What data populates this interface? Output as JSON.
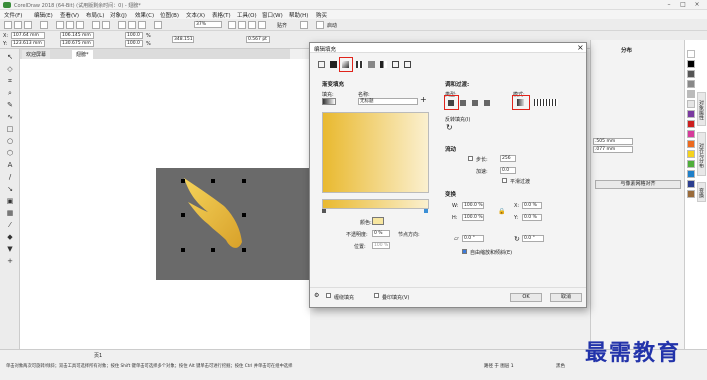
{
  "app": {
    "title": "CorelDraw 2018 (64-Bit) (试用版剩余时间：0) - 翅膀*"
  },
  "menu": [
    "文件(F)",
    "编辑(E)",
    "查看(V)",
    "布局(L)",
    "对象(J)",
    "效果(C)",
    "位图(B)",
    "文本(X)",
    "表格(T)",
    "工具(O)",
    "窗口(W)",
    "帮助(H)",
    "购买"
  ],
  "toolbar": {
    "zoom": "37%",
    "snap_label": "贴齐",
    "launch_label": "启动"
  },
  "propbar": {
    "x": "107.64 mm",
    "y": "123.613 mm",
    "w": "106.145 mm",
    "h": "130.675 mm",
    "sx": "100.0",
    "sy": "100.0",
    "pct": "%",
    "angle": "348.151",
    "outline": "0.567 pt"
  },
  "doc_tabs": {
    "welcome": "欢迎屏幕",
    "doc": "翅膀*"
  },
  "right_panel": {
    "title": "分布",
    "v1": ".505 mm",
    "v2": ".077 mm",
    "align_button": "与像素网格对齐",
    "tabs": [
      "对象属性",
      "对齐与分布",
      "变换"
    ]
  },
  "dialog": {
    "title": "编辑填充",
    "section_gradient": "渐变填充",
    "fill_label": "填充:",
    "name_label": "名称:",
    "name_value": "无标题",
    "color_label": "颜色:",
    "opacity_label": "不透明度:",
    "opacity_value": "0 %",
    "position_label": "位置:",
    "position_value": "100 %",
    "node_dir_label": "节点方向:",
    "section_blend": "调和过渡:",
    "type_label": "类型:",
    "mode_label": "模式:",
    "mirror_label": "反转填充(I)",
    "section_accel": "流动",
    "steps_label": "步长:",
    "steps_value": "256",
    "accel_label": "加速:",
    "accel_value": "0.0",
    "smooth_label": "平滑过渡",
    "section_transform": "变换",
    "w_label": "W:",
    "w_value": "100.0 %",
    "h_label": "H:",
    "h_value": "100.0 %",
    "x_label": "X:",
    "x_value": "0.0 %",
    "y_label": "Y:",
    "y_value": "0.0 %",
    "skew_value": "0.0 °",
    "rotate_value": "0.0 °",
    "free_scale_label": "自由缩放和倾斜(E)",
    "wrap_label": "缠绕填充",
    "overprint_label": "叠印填充(V)",
    "ok": "OK",
    "cancel": "取消",
    "color_swatch": "#f7e6a0",
    "grad_start": "#e9b92f",
    "grad_end": "#fbf0cf"
  },
  "status": {
    "hint": "单击对象两次可旋转/倾斜；双击工具可选择所有对象；按住 Shift 键单击可选择多个对象；按住 Alt 键单击可进行挖掘；按住 Ctrl 并单击可在组中选择",
    "fill_info": "路径 于 图层 1",
    "page_label": "页1",
    "color_none": "黑色"
  },
  "watermark": "最需教育",
  "colors": {
    "accent_red": "#e0241b",
    "wing_gold": "#e6b530"
  }
}
